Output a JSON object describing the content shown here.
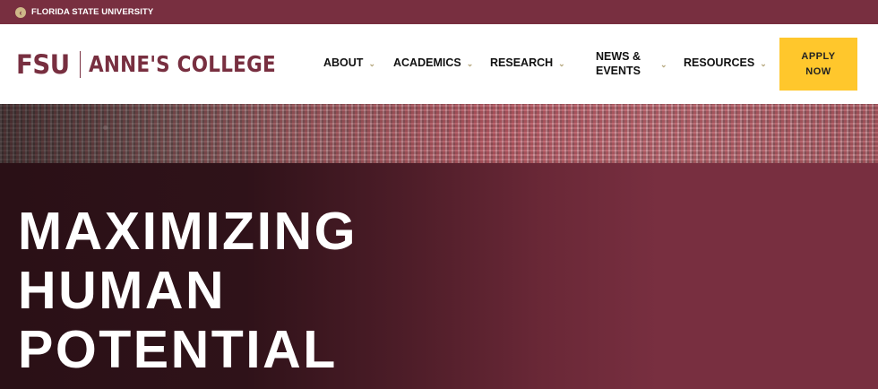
{
  "topbar": {
    "back_icon": "circle-arrow-left-icon",
    "university_link": "FLORIDA STATE UNIVERSITY"
  },
  "header": {
    "logo_mark": "FSU",
    "logo_college": "ANNE'S COLLEGE",
    "nav": [
      {
        "label": "ABOUT"
      },
      {
        "label": "ACADEMICS"
      },
      {
        "label": "RESEARCH"
      },
      {
        "label_line1": "NEWS &",
        "label_line2": "EVENTS"
      },
      {
        "label": "RESOURCES"
      }
    ],
    "chevron_icon": "chevron-down-icon",
    "apply": {
      "line1": "APPLY",
      "line2": "NOW"
    }
  },
  "hero": {
    "lines": [
      "MAXIMIZING",
      "HUMAN",
      "POTENTIAL"
    ]
  },
  "colors": {
    "garnet": "#782f40",
    "gold": "#ceb888",
    "apply_yellow": "#ffc72c"
  }
}
